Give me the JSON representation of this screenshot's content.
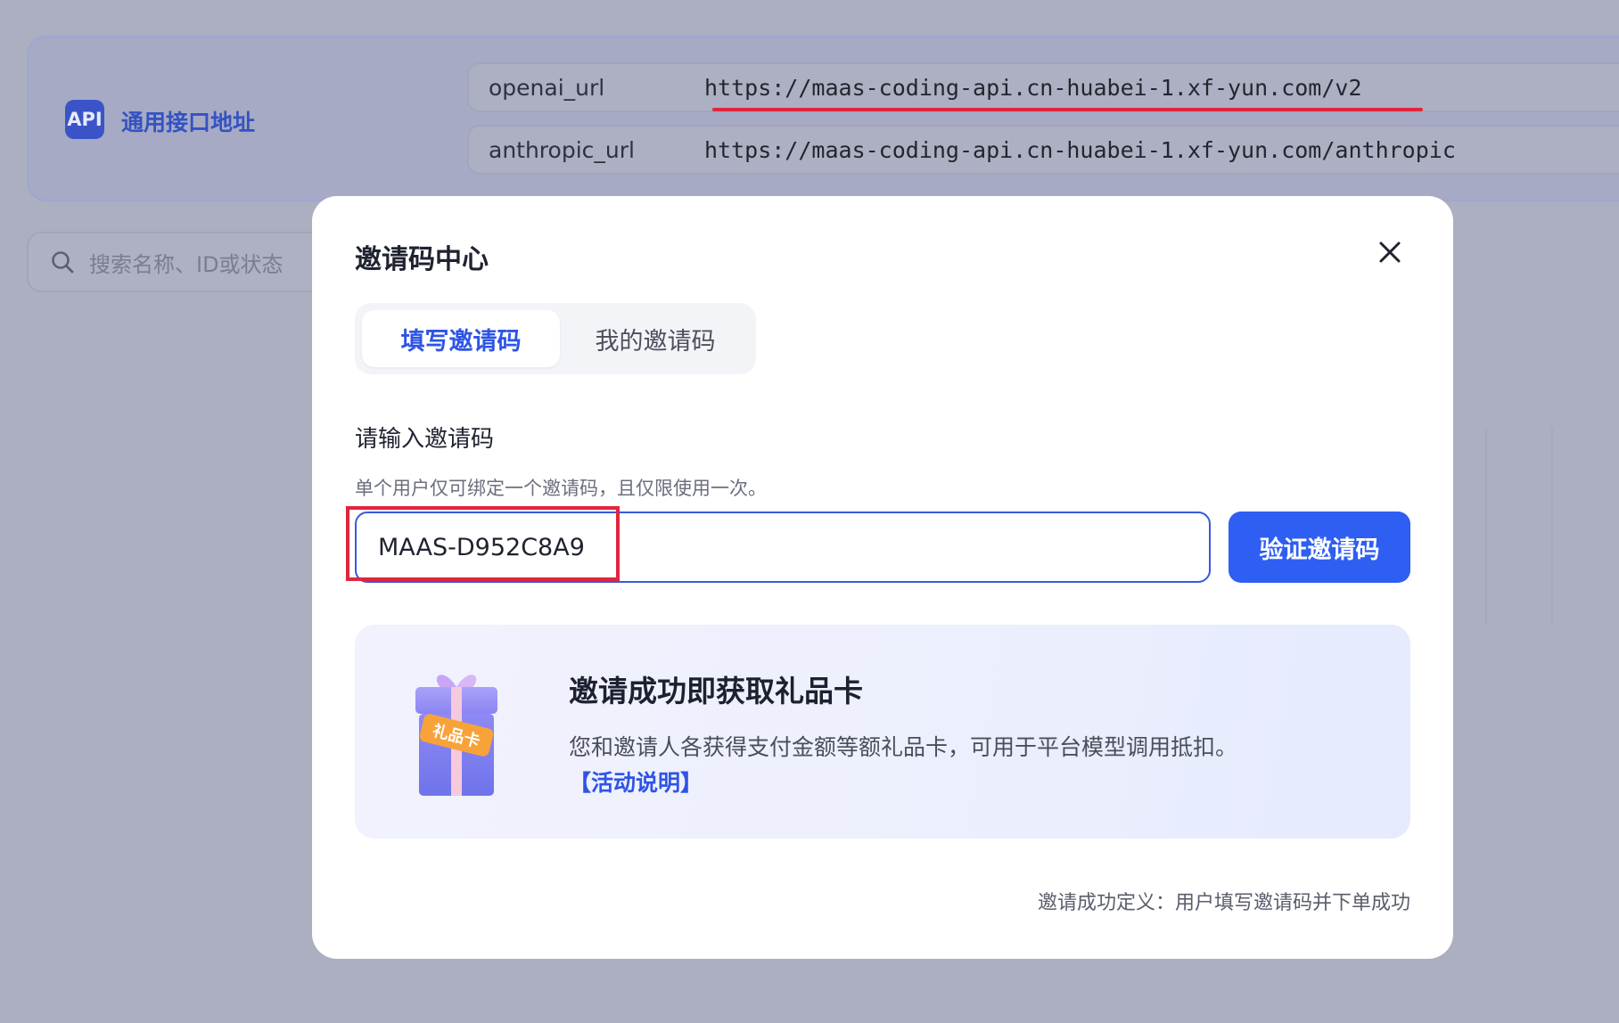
{
  "background": {
    "api_badge": "API",
    "api_title": "通用接口地址",
    "urls": [
      {
        "key": "openai_url",
        "value": "https://maas-coding-api.cn-huabei-1.xf-yun.com/v2"
      },
      {
        "key": "anthropic_url",
        "value": "https://maas-coding-api.cn-huabei-1.xf-yun.com/anthropic"
      }
    ],
    "search_placeholder": "搜索名称、ID或状态"
  },
  "modal": {
    "title": "邀请码中心",
    "tabs": [
      {
        "label": "填写邀请码",
        "active": true
      },
      {
        "label": "我的邀请码",
        "active": false
      }
    ],
    "field_label": "请输入邀请码",
    "field_hint": "单个用户仅可绑定一个邀请码，且仅限使用一次。",
    "code_value": "MAAS-D952C8A9",
    "verify_label": "验证邀请码",
    "promo": {
      "gift_tag": "礼品卡",
      "title": "邀请成功即获取礼品卡",
      "description": "您和邀请人各获得支付金额等额礼品卡，可用于平台模型调用抵扣。",
      "link": "【活动说明】"
    },
    "footer_note": "邀请成功定义：用户填写邀请码并下单成功"
  },
  "colors": {
    "accent": "#2e5ff2",
    "highlight_red": "#e0253f",
    "overlay": "#abafbf"
  }
}
